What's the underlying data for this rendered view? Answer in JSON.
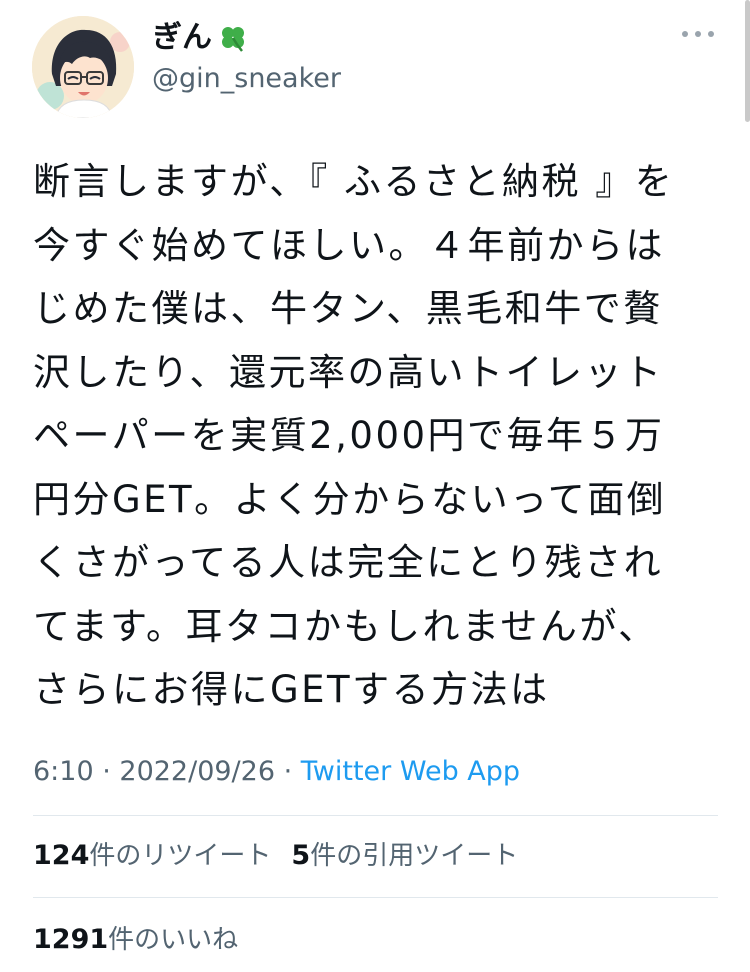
{
  "user": {
    "display_name": "ぎん",
    "name_emoji_icon": "four-leaf-clover-icon",
    "handle": "@gin_sneaker"
  },
  "tweet": {
    "lines": [
      "断言しますが、『 ふるさと納税 』を",
      "今すぐ始めてほしい。４年前からは",
      "じめた僕は、牛タン、黒毛和牛で贅",
      "沢したり、還元率の高いトイレット",
      "ペーパーを実質2,000円で毎年５万",
      "円分GET。よく分からないって面倒",
      "くさがってる人は完全にとり残され",
      "てます。耳タコかもしれませんが、",
      "さらにお得にGETする方法は"
    ]
  },
  "meta": {
    "time": "6:10",
    "sep1": " · ",
    "date": "2022/09/26",
    "sep2": " · ",
    "source": "Twitter Web App"
  },
  "stats": {
    "retweets_count": "124",
    "retweets_label": "件のリツイート",
    "quotes_count": "5",
    "quotes_label": "件の引用ツイート",
    "likes_count": "1291",
    "likes_label": "件のいいね"
  },
  "colors": {
    "text": "#0f1419",
    "secondary": "#536471",
    "link": "#1d9bf0",
    "divider": "#e1e8ed"
  }
}
